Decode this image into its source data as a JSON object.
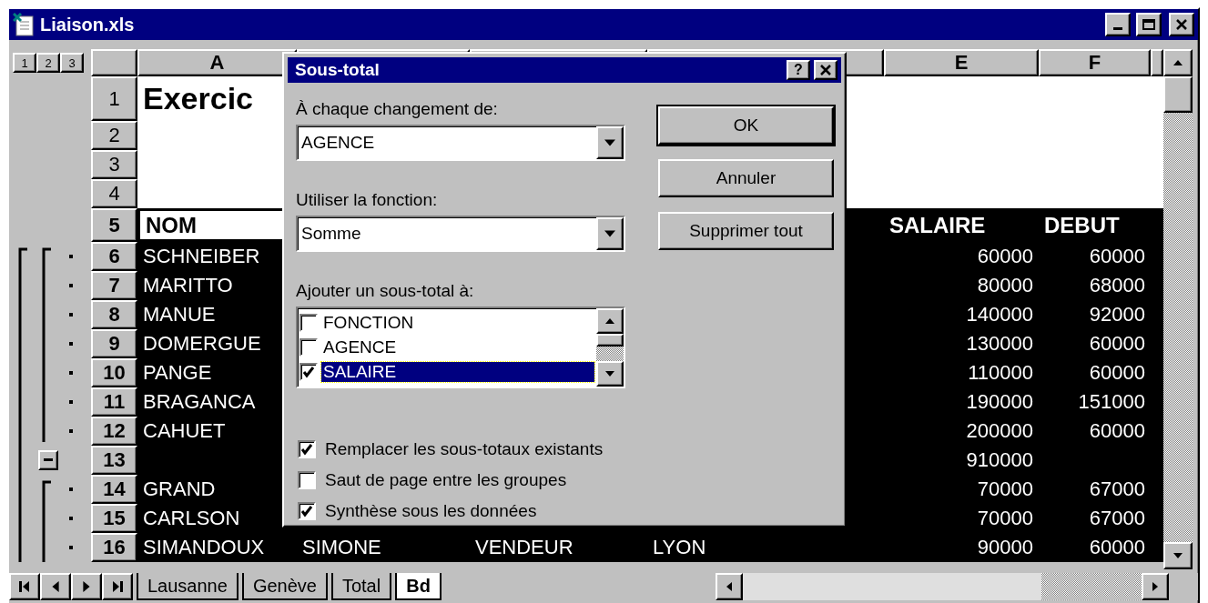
{
  "window": {
    "title": "Liaison.xls"
  },
  "outline_levels": [
    "1",
    "2",
    "3"
  ],
  "column_headers": {
    "A": "A",
    "E": "E",
    "F": "F"
  },
  "rows": [
    {
      "number": "1",
      "kind": "title",
      "detail_marker": false,
      "collapse_button": false,
      "selected": false,
      "active": false,
      "cells": {
        "A": "Exercic"
      }
    },
    {
      "number": "2",
      "kind": "blank",
      "detail_marker": false,
      "collapse_button": false,
      "selected": false,
      "active": false
    },
    {
      "number": "3",
      "kind": "blank",
      "detail_marker": false,
      "collapse_button": false,
      "selected": false,
      "active": false
    },
    {
      "number": "4",
      "kind": "blank",
      "detail_marker": false,
      "collapse_button": false,
      "selected": false,
      "active": false
    },
    {
      "number": "5",
      "kind": "header",
      "detail_marker": false,
      "collapse_button": false,
      "selected": true,
      "active": true,
      "cells": {
        "A": "NOM",
        "E": "SALAIRE",
        "F": "DEBUT"
      }
    },
    {
      "number": "6",
      "kind": "data",
      "detail_marker": true,
      "collapse_button": false,
      "selected": true,
      "active": false,
      "cells": {
        "A": "SCHNEIBER",
        "E": "60000",
        "F": "60000"
      }
    },
    {
      "number": "7",
      "kind": "data",
      "detail_marker": true,
      "collapse_button": false,
      "selected": true,
      "active": false,
      "cells": {
        "A": "MARITTO",
        "E": "80000",
        "F": "68000"
      }
    },
    {
      "number": "8",
      "kind": "data",
      "detail_marker": true,
      "collapse_button": false,
      "selected": true,
      "active": false,
      "cells": {
        "A": "MANUE",
        "E": "140000",
        "F": "92000"
      }
    },
    {
      "number": "9",
      "kind": "data",
      "detail_marker": true,
      "collapse_button": false,
      "selected": true,
      "active": false,
      "cells": {
        "A": "DOMERGUE",
        "E": "130000",
        "F": "60000"
      }
    },
    {
      "number": "10",
      "kind": "data",
      "detail_marker": true,
      "collapse_button": false,
      "selected": true,
      "active": false,
      "cells": {
        "A": "PANGE",
        "E": "110000",
        "F": "60000"
      }
    },
    {
      "number": "11",
      "kind": "data",
      "detail_marker": true,
      "collapse_button": false,
      "selected": true,
      "active": false,
      "cells": {
        "A": "BRAGANCA",
        "E": "190000",
        "F": "151000"
      }
    },
    {
      "number": "12",
      "kind": "data",
      "detail_marker": true,
      "collapse_button": false,
      "selected": true,
      "active": false,
      "cells": {
        "A": "CAHUET",
        "E": "200000",
        "F": "60000"
      }
    },
    {
      "number": "13",
      "kind": "data",
      "detail_marker": false,
      "collapse_button": true,
      "selected": true,
      "active": false,
      "cells": {
        "E": "910000"
      }
    },
    {
      "number": "14",
      "kind": "data",
      "detail_marker": true,
      "collapse_button": false,
      "selected": true,
      "active": false,
      "cells": {
        "A": "GRAND",
        "E": "70000",
        "F": "67000"
      }
    },
    {
      "number": "15",
      "kind": "data",
      "detail_marker": true,
      "collapse_button": false,
      "selected": true,
      "active": false,
      "cells": {
        "A": "CARLSON",
        "E": "70000",
        "F": "67000"
      }
    },
    {
      "number": "16",
      "kind": "data",
      "detail_marker": true,
      "collapse_button": false,
      "selected": true,
      "active": false,
      "cells": {
        "A": "SIMANDOUX",
        "B": "SIMONE",
        "C": "VENDEUR",
        "D": "LYON",
        "E": "90000",
        "F": "60000"
      }
    }
  ],
  "sheet_tabs": [
    {
      "label": "Lausanne",
      "selected": false
    },
    {
      "label": "Genève",
      "selected": false
    },
    {
      "label": "Total",
      "selected": false
    },
    {
      "label": "Bd",
      "selected": true
    }
  ],
  "dialog": {
    "title": "Sous-total",
    "help": "?",
    "group_by": {
      "label": "À chaque changement de:",
      "value": "AGENCE"
    },
    "function": {
      "label": "Utiliser la fonction:",
      "value": "Somme"
    },
    "subtotal_list": {
      "label": "Ajouter un sous-total à:",
      "items": [
        {
          "label": "FONCTION",
          "checked": false,
          "selected": false
        },
        {
          "label": "AGENCE",
          "checked": false,
          "selected": false
        },
        {
          "label": "SALAIRE",
          "checked": true,
          "selected": true
        }
      ]
    },
    "buttons": [
      {
        "label": "OK",
        "default": true
      },
      {
        "label": "Annuler",
        "default": false
      },
      {
        "label": "Supprimer tout",
        "default": false
      }
    ],
    "options": [
      {
        "label": "Remplacer les sous-totaux existants",
        "checked": true
      },
      {
        "label": "Saut de page entre les groupes",
        "checked": false
      },
      {
        "label": "Synthèse sous les données",
        "checked": true
      }
    ]
  }
}
